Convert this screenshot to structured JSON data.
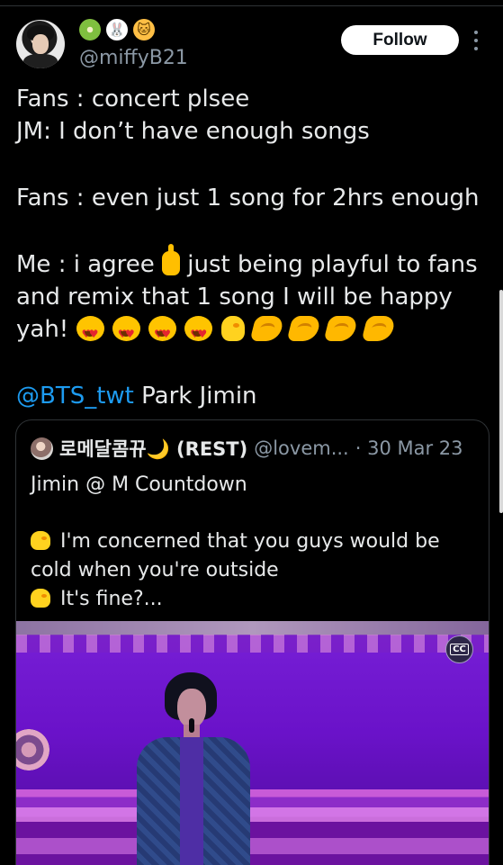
{
  "header": {
    "display_name_emojis": [
      "kiwi",
      "rabbit",
      "cat"
    ],
    "handle": "@miffyB21",
    "follow_label": "Follow"
  },
  "tweet": {
    "lines": [
      "Fans : concert plsee",
      "JM: I don’t have enough songs",
      "Fans : even just 1 song for 2hrs enough",
      "Me : i agree",
      " just being playful to fans",
      "and remix that 1 song I will be happy",
      "yah!",
      "@BTS_twt",
      " Park Jimin"
    ],
    "emoji_sequence": [
      "heart-eyes",
      "heart-eyes",
      "heart-eyes",
      "heart-eyes",
      "chick",
      "hand",
      "hand",
      "hand",
      "hand"
    ]
  },
  "quote": {
    "name": "로메달콤뀨🌙 (REST)",
    "handle": "@lovem...",
    "date": "· 30 Mar 23",
    "text_lines": [
      "Jimin @ M Countdown",
      "I'm concerned that you guys would be",
      "cold when you're outside",
      "It's fine?..."
    ],
    "media": {
      "caption_button": "CC"
    }
  },
  "colors": {
    "background": "#000000",
    "text": "#e7e9ea",
    "muted": "#8b98a5",
    "link": "#1d9bf0",
    "border": "#2f3336",
    "stage": "#6c18c6"
  }
}
